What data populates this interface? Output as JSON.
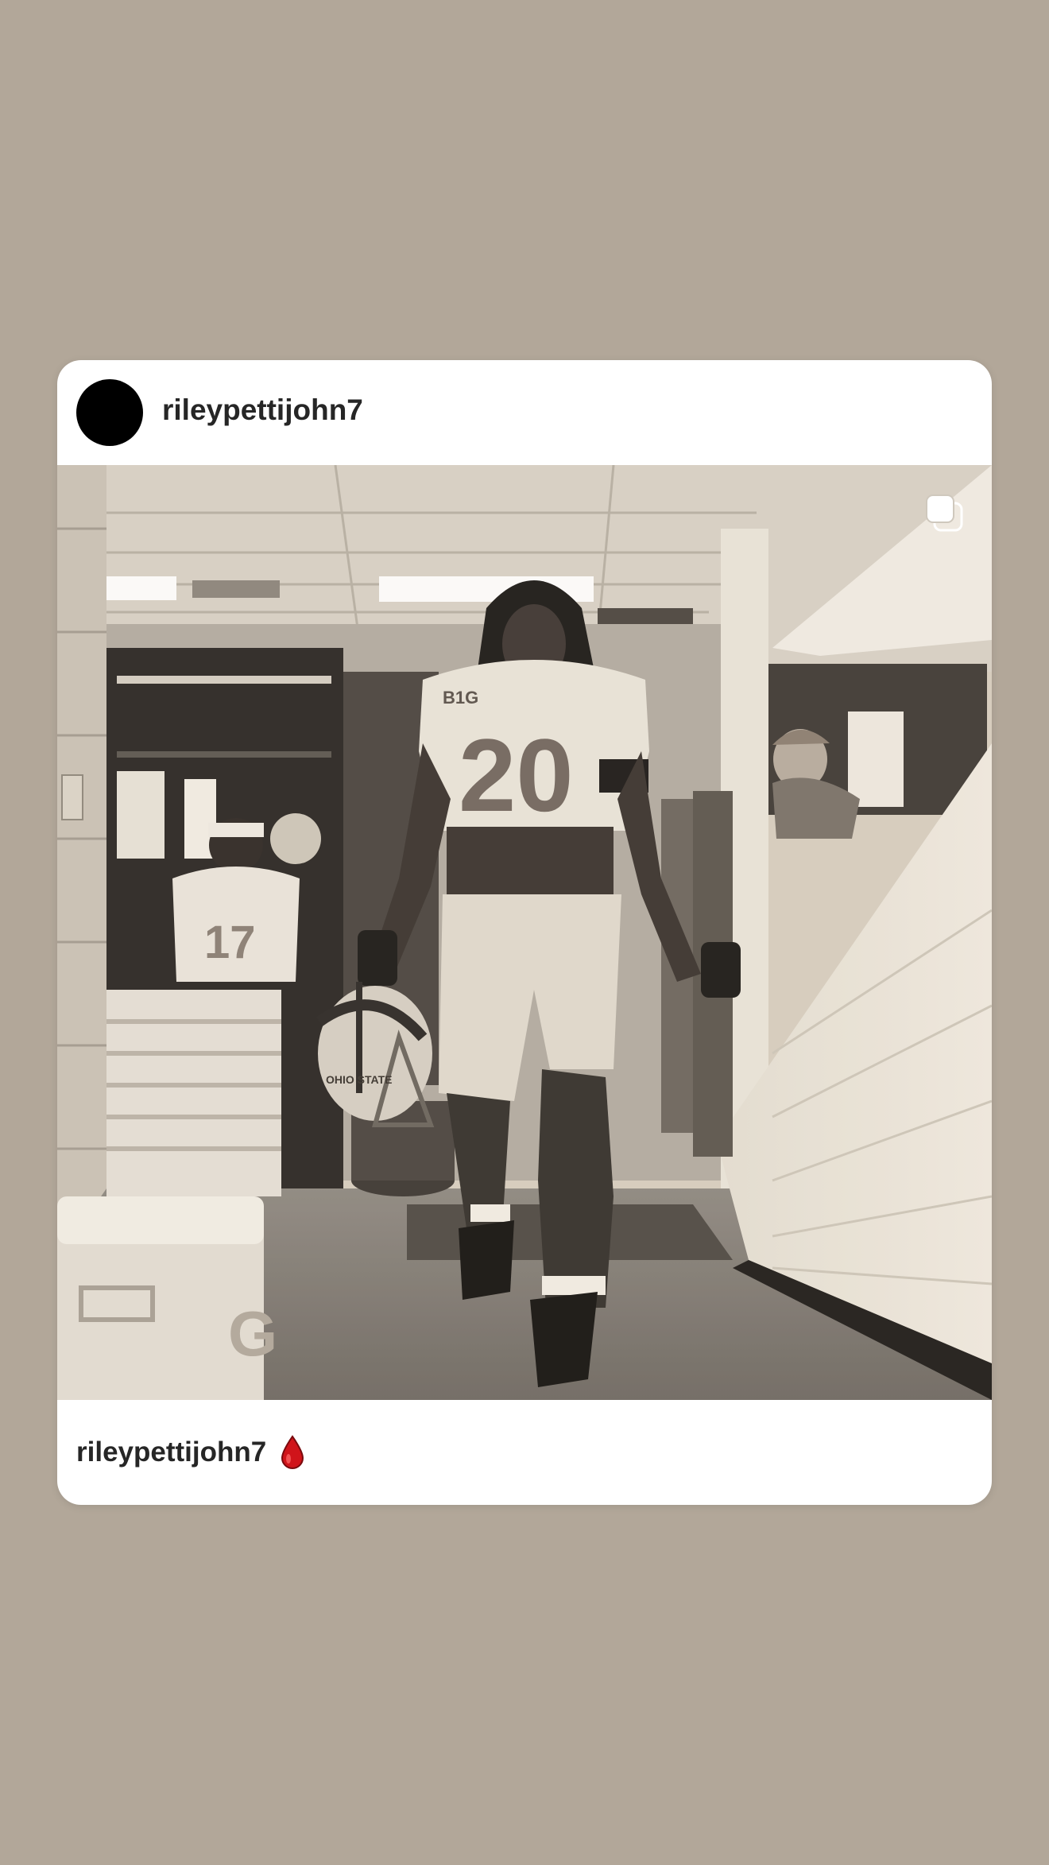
{
  "post": {
    "header": {
      "username": "rileypettijohn7",
      "avatar_icon": "avatar-circle-icon"
    },
    "media": {
      "type_icon": "multiple-images-icon",
      "jersey_number": "20",
      "teammate_number": "17",
      "helmet_text": "OHIO STATE",
      "jersey_patch": "B1G",
      "cooler_letter": "G"
    },
    "caption": {
      "username": "rileypettijohn7",
      "emoji_icon": "red-drop-icon"
    }
  },
  "colors": {
    "background": "#b2a799",
    "card": "#ffffff",
    "text": "#262626",
    "drop": "#d0141a"
  }
}
